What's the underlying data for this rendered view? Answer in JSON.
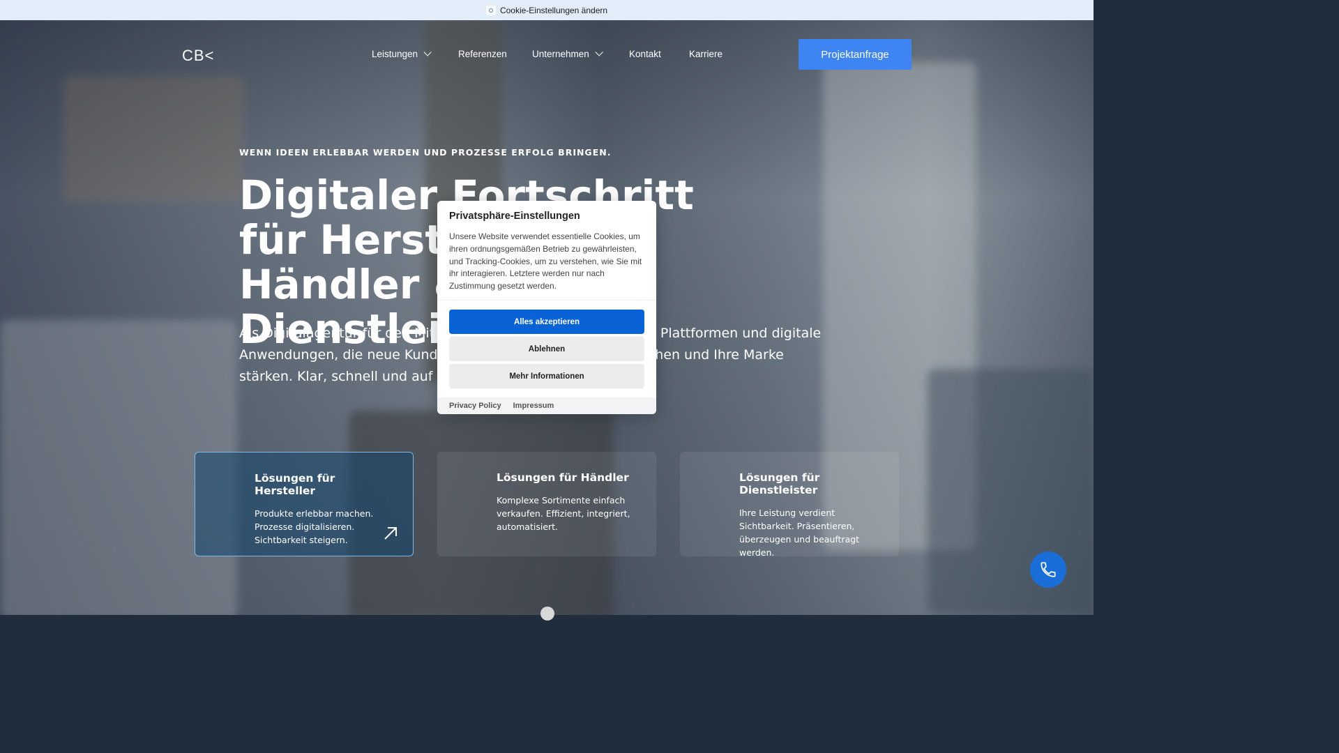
{
  "topbar": {
    "icon": "cookie-settings-icon",
    "text": "Cookie-Einstellungen ändern"
  },
  "header": {
    "logo": "CB<",
    "nav": [
      {
        "label": "Leistungen",
        "dropdown": true
      },
      {
        "label": "Referenzen",
        "dropdown": false
      },
      {
        "label": "Unternehmen",
        "dropdown": true
      },
      {
        "label": "Kontakt",
        "dropdown": false
      },
      {
        "label": "Karriere",
        "dropdown": false
      }
    ],
    "cta": "Projektanfrage"
  },
  "hero": {
    "kicker": "WENN IDEEN ERLEBBAR WERDEN UND PROZESSE ERFOLG BRINGEN.",
    "headline": "Digitaler Fortschritt für Hersteller, Händler & Dienstleister",
    "lead": "Als Digitalagentur für den Mittelstand entwickeln wir Websites, Plattformen und digitale Anwendungen, die neue Kunden gewinnen, Prozesse vereinfachen und Ihre Marke stärken. Klar, schnell und auf den Punkt."
  },
  "cards": [
    {
      "title": "Lösungen für Hersteller",
      "text": "Produkte erlebbar machen. Prozesse digitalisieren. Sichtbarkeit steigern.",
      "active": true
    },
    {
      "title": "Lösungen für Händler",
      "text": "Komplexe Sortimente einfach verkaufen. Effizient, integriert, automatisiert.",
      "active": false
    },
    {
      "title": "Lösungen für Dienstleister",
      "text": "Ihre Leistung verdient Sichtbarkeit. Präsentieren, überzeugen und beauftragt werden.",
      "active": false
    }
  ],
  "modal": {
    "title": "Privatsphäre-Einstellungen",
    "text": "Unsere Website verwendet essentielle Cookies, um ihren ordnungsgemäßen Betrieb zu gewährleisten, und Tracking-Cookies, um zu verstehen, wie Sie mit ihr interagieren. Letztere werden nur nach Zustimmung gesetzt werden.",
    "accept": "Alles akzeptieren",
    "decline": "Ablehnen",
    "more": "Mehr Informationen",
    "footer_links": [
      "Privacy Policy",
      "Impressum"
    ]
  },
  "colors": {
    "accent": "#3e84f2",
    "modal_primary": "#0a63d6",
    "phone_button": "#1a6ed8"
  }
}
